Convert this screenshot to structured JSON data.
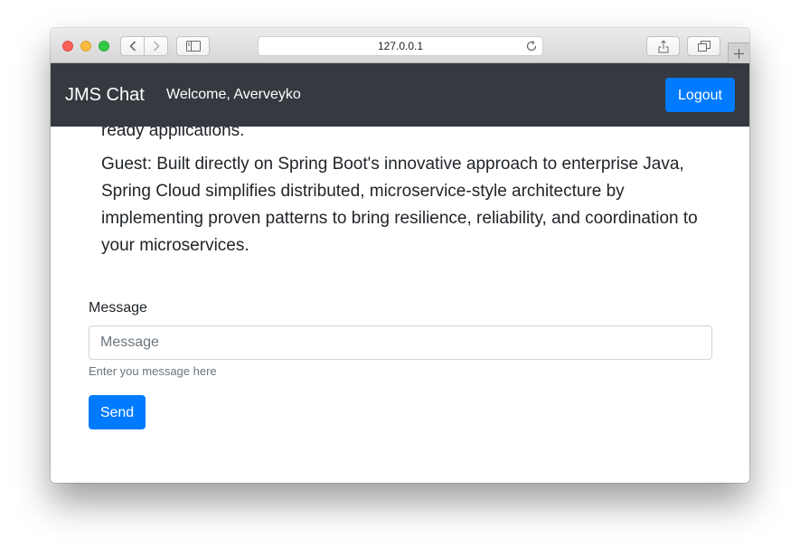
{
  "browser": {
    "url": "127.0.0.1"
  },
  "navbar": {
    "brand": "JMS Chat",
    "welcome": "Welcome, Averveyko",
    "logout_label": "Logout",
    "background_color": "#343a40",
    "button_color": "#007bff"
  },
  "messages": [
    {
      "text": "platforms, Guest: Spring Boot takes an opinionated view of building production ready applications."
    },
    {
      "text": "Guest: Built directly on Spring Boot's innovative approach to enterprise Java, Spring Cloud simplifies distributed, microservice-style architecture by implementing proven patterns to bring resilience, reliability, and coordination to your microservices."
    }
  ],
  "form": {
    "label": "Message",
    "placeholder": "Message",
    "value": "",
    "help_text": "Enter you message here",
    "send_label": "Send"
  }
}
